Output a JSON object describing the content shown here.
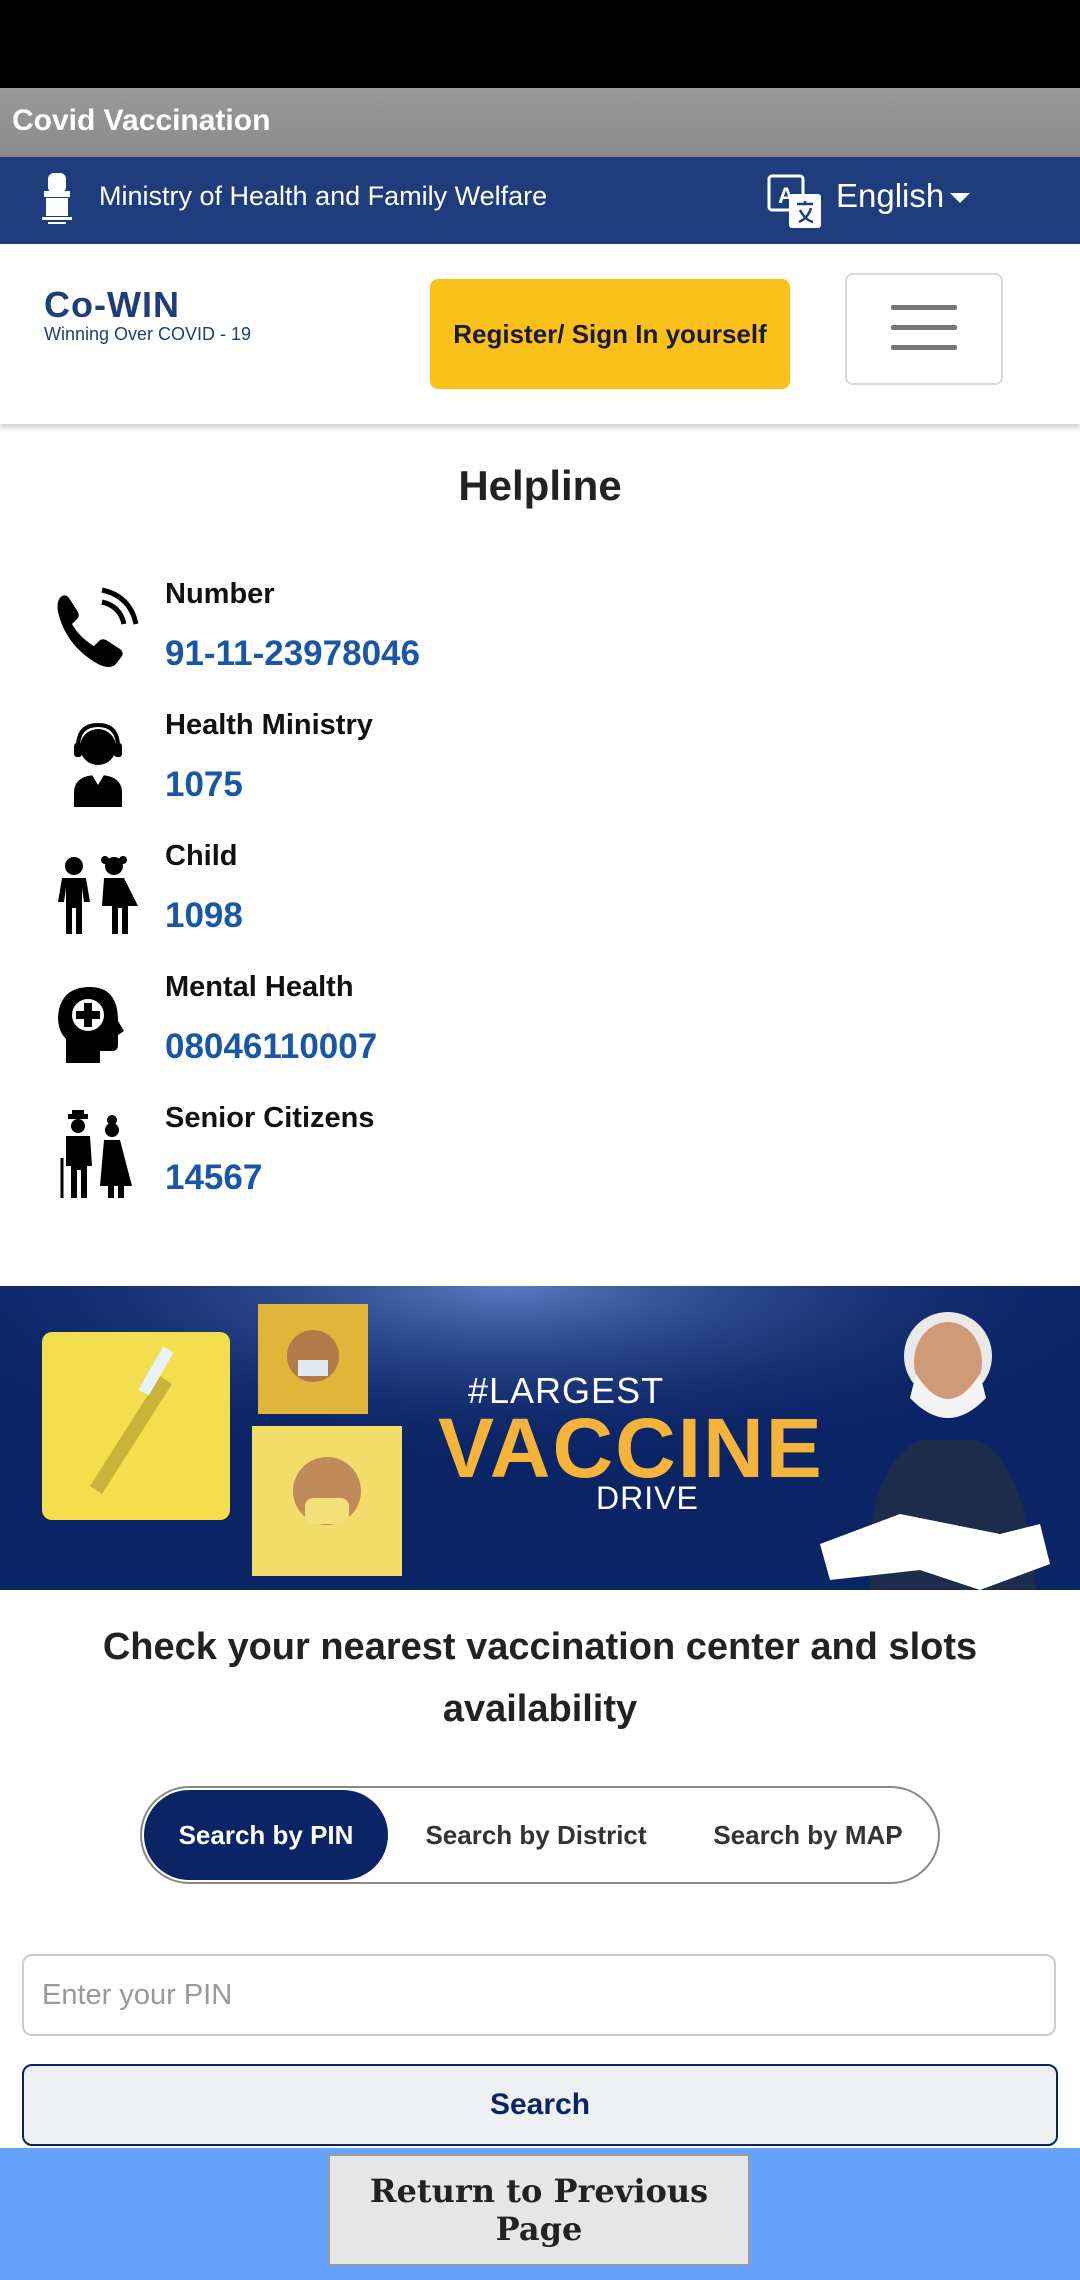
{
  "app": {
    "title": "Covid Vaccination"
  },
  "ministry_bar": {
    "label": "Ministry of Health and Family Welfare",
    "language": "English"
  },
  "header": {
    "logo_brand": "Co-WIN",
    "logo_tagline": "Winning Over COVID - 19",
    "register_label": "Register/ Sign In yourself"
  },
  "helpline": {
    "title": "Helpline",
    "items": [
      {
        "name": "Number",
        "value": "91-11-23978046",
        "icon": "phone-icon"
      },
      {
        "name": "Health Ministry",
        "value": "1075",
        "icon": "headset-agent-icon"
      },
      {
        "name": "Child",
        "value": "1098",
        "icon": "children-icon"
      },
      {
        "name": "Mental Health",
        "value": "08046110007",
        "icon": "mental-health-head-icon"
      },
      {
        "name": "Senior Citizens",
        "value": "14567",
        "icon": "senior-citizens-icon"
      }
    ]
  },
  "banner": {
    "line1": "#LARGEST",
    "line2": "VACCINE",
    "line3": "DRIVE"
  },
  "search": {
    "title": "Check your nearest vaccination center and slots availability",
    "tabs": [
      "Search by PIN",
      "Search by District",
      "Search by MAP"
    ],
    "pin_placeholder": "Enter your PIN",
    "search_label": "Search"
  },
  "footer": {
    "return_label": "Return to Previous Page"
  },
  "colors": {
    "navy": "#0a2466",
    "ministry": "#1f3d7c",
    "accent": "#fbc01a",
    "link": "#1a56a8"
  }
}
